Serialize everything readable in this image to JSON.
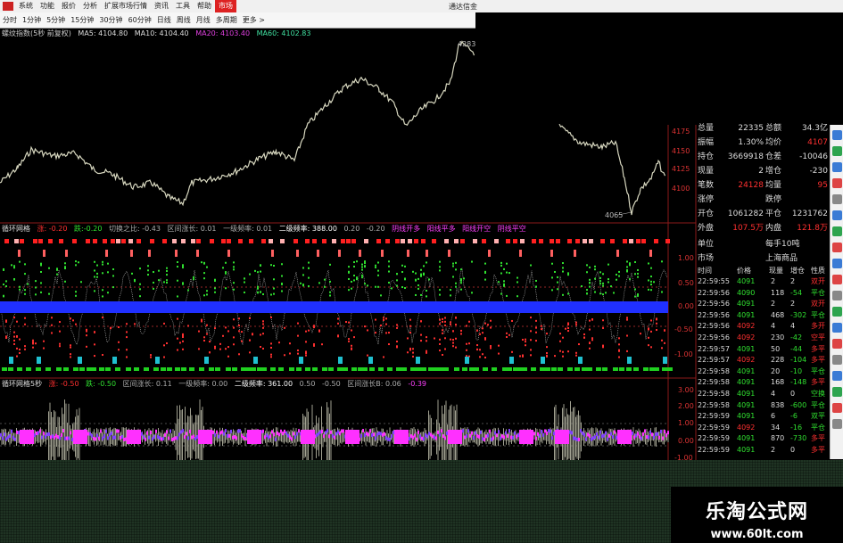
{
  "menu": {
    "items": [
      "系统",
      "功能",
      "报价",
      "分析",
      "扩展市场行情",
      "资讯",
      "工具",
      "帮助"
    ],
    "active": "市场",
    "right_title": "通达信金"
  },
  "periods": [
    "分时",
    "1分钟",
    "5分钟",
    "15分钟",
    "30分钟",
    "60分钟",
    "日线",
    "周线",
    "月线",
    "多周期",
    "更多 >"
  ],
  "main_legend": {
    "title": "螺纹指数(5秒 前复权)",
    "ma5": "MA5: 4104.80",
    "ma10": "MA10: 4104.40",
    "ma20": "MA20: 4103.40",
    "ma60": "MA60: 4102.83"
  },
  "price_labels": {
    "high": "4283",
    "low": "4065"
  },
  "price_axis": [
    "4175",
    "4150",
    "4125",
    "4100"
  ],
  "panel1": {
    "title": "循环网格",
    "items": [
      "涨: -0.20",
      "跌:-0.20",
      "切换之比: -0.43",
      "区间涨长: 0.01",
      "一级频率: 0.01",
      "二级频率: 388.00",
      "0.20",
      "-0.20",
      "阴线开多",
      "阳线平多",
      "阳线开空",
      "阴线平空"
    ],
    "axis": [
      "1.00",
      "0.50",
      "0.00",
      "-0.50",
      "-1.00"
    ]
  },
  "panel2": {
    "title": "循环网格5秒",
    "items": [
      "涨: -0.50",
      "跌: -0.50",
      "区间涨长: 0.11",
      "一级频率: 0.00",
      "二级频率: 361.00",
      "0.50",
      "-0.50",
      "区间涨长B: 0.06",
      "-0.39"
    ],
    "axis": [
      "3.00",
      "2.00",
      "1.00",
      "0.00",
      "-1.00"
    ]
  },
  "quote": {
    "rows": [
      {
        "l1": "总量",
        "v1": "22335",
        "l2": "总额",
        "v2": "34.3亿"
      },
      {
        "l1": "振幅",
        "v1": "1.30%",
        "l2": "均价",
        "v2": "4107"
      },
      {
        "l1": "持仓",
        "v1": "3669918",
        "l2": "仓差",
        "v2": "-10046"
      },
      {
        "l1": "现量",
        "v1": "2",
        "l2": "增仓",
        "v2": "-230"
      },
      {
        "l1": "笔数",
        "v1": "24128",
        "l2": "均量",
        "v2": "95"
      },
      {
        "l1": "涨停",
        "v1": "",
        "l2": "跌停",
        "v2": ""
      },
      {
        "l1": "开仓",
        "v1": "1061282",
        "l2": "平仓",
        "v2": "1231762"
      },
      {
        "l1": "外盘",
        "v1": "107.5万",
        "l2": "内盘",
        "v2": "121.8万"
      },
      {
        "l1": "单位",
        "v1": "",
        "l2": "每手10吨",
        "v2": ""
      },
      {
        "l1": "市场",
        "v1": "",
        "l2": "上海商品",
        "v2": ""
      }
    ],
    "tick_headers": [
      "时间",
      "价格",
      "现量",
      "增仓",
      "性质"
    ],
    "ticks": [
      [
        "22:59:55",
        "4091",
        "2",
        "2",
        "双开"
      ],
      [
        "22:59:56",
        "4090",
        "118",
        "-54",
        "平仓"
      ],
      [
        "22:59:56",
        "4091",
        "2",
        "2",
        "双开"
      ],
      [
        "22:59:56",
        "4091",
        "468",
        "-302",
        "平仓"
      ],
      [
        "22:59:56",
        "4092",
        "4",
        "4",
        "多开"
      ],
      [
        "22:59:56",
        "4092",
        "230",
        "-42",
        "空平"
      ],
      [
        "22:59:57",
        "4091",
        "50",
        "-44",
        "多平"
      ],
      [
        "22:59:57",
        "4092",
        "228",
        "-104",
        "多平"
      ],
      [
        "22:59:58",
        "4091",
        "20",
        "-10",
        "平仓"
      ],
      [
        "22:59:58",
        "4091",
        "168",
        "-148",
        "多平"
      ],
      [
        "22:59:58",
        "4091",
        "4",
        "0",
        "空换"
      ],
      [
        "22:59:58",
        "4091",
        "838",
        "-600",
        "平仓"
      ],
      [
        "22:59:59",
        "4091",
        "6",
        "-6",
        "双平"
      ],
      [
        "22:59:59",
        "4092",
        "34",
        "-16",
        "平仓"
      ],
      [
        "22:59:59",
        "4091",
        "870",
        "-730",
        "多平"
      ],
      [
        "22:59:59",
        "4091",
        "2",
        "0",
        "多平"
      ]
    ]
  },
  "watermark": {
    "title": "乐淘公式网",
    "url": "www.60lt.com"
  },
  "colors": {
    "price_line": "#d8d8c0",
    "ma20": "#e040e0",
    "ma60": "#40e0a0",
    "up": "#ff3030",
    "down": "#30e030",
    "blue_band": "#2030ff",
    "magenta": "#ff30ff",
    "accent": "#ff4040"
  }
}
